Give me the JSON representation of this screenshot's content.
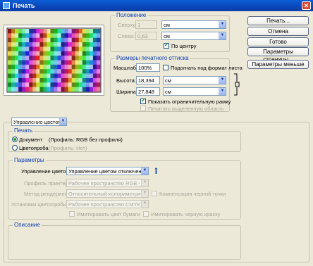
{
  "window": {
    "title": "Печать",
    "close_glyph": "✕"
  },
  "position_group": {
    "title": "Положение",
    "top_label": "Сверху:",
    "top_value": "1",
    "top_unit": "см",
    "left_label": "Слева:",
    "left_value": "0,63",
    "left_unit": "см",
    "center_label": "По центру",
    "center_checked": true
  },
  "size_group": {
    "title": "Размеры печатного оттиска",
    "scale_label": "Масштаб:",
    "scale_value": "100%",
    "fit_label": "Подогнать под формат листа",
    "height_label": "Высота:",
    "height_value": "18,394",
    "height_unit": "см",
    "width_label": "Ширина:",
    "width_value": "27,848",
    "width_unit": "см",
    "bbox_label": "Показать ограничительную рамку",
    "print_sel_label": "Печатать выделенную область"
  },
  "buttons": {
    "print": "Печать...",
    "cancel": "Отмена",
    "done": "Готово",
    "page_setup": "Параметры страницы...",
    "fewer_options": "Параметры меньше"
  },
  "color_mgmt_select": "Управление цветом",
  "print_group": {
    "title": "Печать",
    "document_label": "Документ",
    "document_profile": "(Профиль: RGB без профиля)",
    "proof_label": "Цветопроба",
    "proof_profile": "(Профиль: Нет)"
  },
  "params_group": {
    "title": "Параметры",
    "color_handling_label": "Управление цветом:",
    "color_handling_value": "Управление цветом отключено",
    "printer_profile_label": "Профиль принтера:",
    "printer_profile_value": "Рабочее пространство RGB - sR...",
    "intent_label": "Метод рендеринга:",
    "intent_value": "Относительный колориметриче...",
    "bpc_label": "Компенсация черной точки",
    "proof_setup_label": "Установки цветопробы:",
    "proof_setup_value": "Рабочее пространство CMYK",
    "sim_paper_label": "Имитировать цвет бумаги",
    "sim_black_label": "Имитировать черную краску"
  },
  "description_group": {
    "title": "Описание"
  },
  "colors": {
    "title_bar": "#0b46b8",
    "group_title": "#0b3db4",
    "dialog_bg": "#ece9d8"
  }
}
